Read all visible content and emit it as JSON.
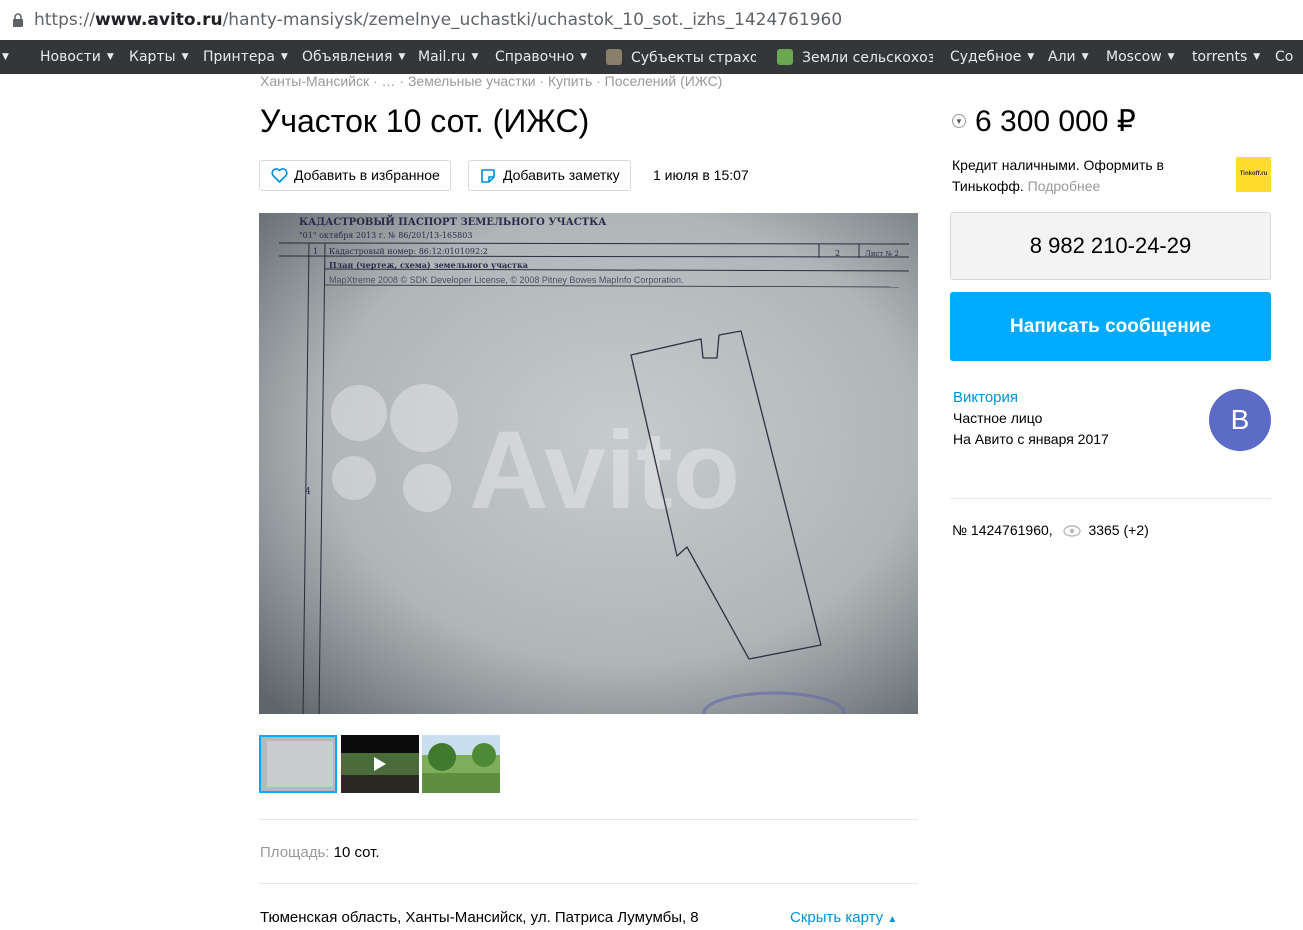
{
  "browser": {
    "url_prefix": "https://",
    "url_domain": "www.avito.ru",
    "url_path": "/hanty-mansiysk/zemelnye_uchastki/uchastok_10_sot._izhs_1424761960"
  },
  "bookmarks": [
    {
      "label": "Новости"
    },
    {
      "label": "Карты"
    },
    {
      "label": "Принтера"
    },
    {
      "label": "Объявления"
    },
    {
      "label": "Mail.ru"
    },
    {
      "label": "Справочно"
    },
    {
      "label": "Субъекты страхов"
    },
    {
      "label": "Земли сельскохоз"
    },
    {
      "label": "Судебное"
    },
    {
      "label": "Али"
    },
    {
      "label": "Moscow"
    },
    {
      "label": "torrents"
    },
    {
      "label": "Co"
    }
  ],
  "breadcrumb": "Ханты-Мансийск · … · Земельные участки · Купить · Поселений (ИЖС)",
  "listing": {
    "title": "Участок 10 сот. (ИЖС)",
    "add_favorite": "Добавить в избранное",
    "add_note": "Добавить заметку",
    "date": "1 июля в 15:07",
    "photo": {
      "header_title": "КАДАСТРОВЫЙ ПАСПОРТ ЗЕМЕЛЬНОГО УЧАСТКА",
      "header_date": "\"01\" октября 2013 г.  № 86/201/13-165803",
      "row1_num": "1",
      "row1_text": "Кадастровый номер:  86:12:0101092:2",
      "row1_col": "2",
      "row1_sheet": "Лист № 2",
      "row2_text": "План (чертеж, схема) земельного участка",
      "row3_text": "MapXtreme 2008 © SDK Developer License, © 2008 Pitney Bowes MapInfo Corporation.",
      "side_num": "4",
      "watermark": "Avito"
    },
    "area_label": "Площадь:",
    "area_value": "10 сот.",
    "address": "Тюменская область, Ханты-Мансийск, ул. Патриса Лумумбы, 8",
    "hide_map": "Скрыть карту"
  },
  "sidebar": {
    "price": "6 300 000 ₽",
    "credit_text": "Кредит наличными. Оформить в Тинькофф.",
    "credit_more": "Подробнее",
    "tinkoff_logo": "Tinkoff.ru",
    "phone": "8 982 210-24-29",
    "write_message": "Написать сообщение",
    "seller_name": "Виктория",
    "seller_type": "Частное лицо",
    "seller_since": "На Авито с января 2017",
    "avatar_letter": "В",
    "ad_number": "№ 1424761960,",
    "views": "3365 (+2)"
  },
  "colors": {
    "accent_blue": "#00aaff",
    "link_blue": "#0091d9",
    "avatar": "#5b6bc6",
    "bookmarks_bg": "#35363a"
  }
}
